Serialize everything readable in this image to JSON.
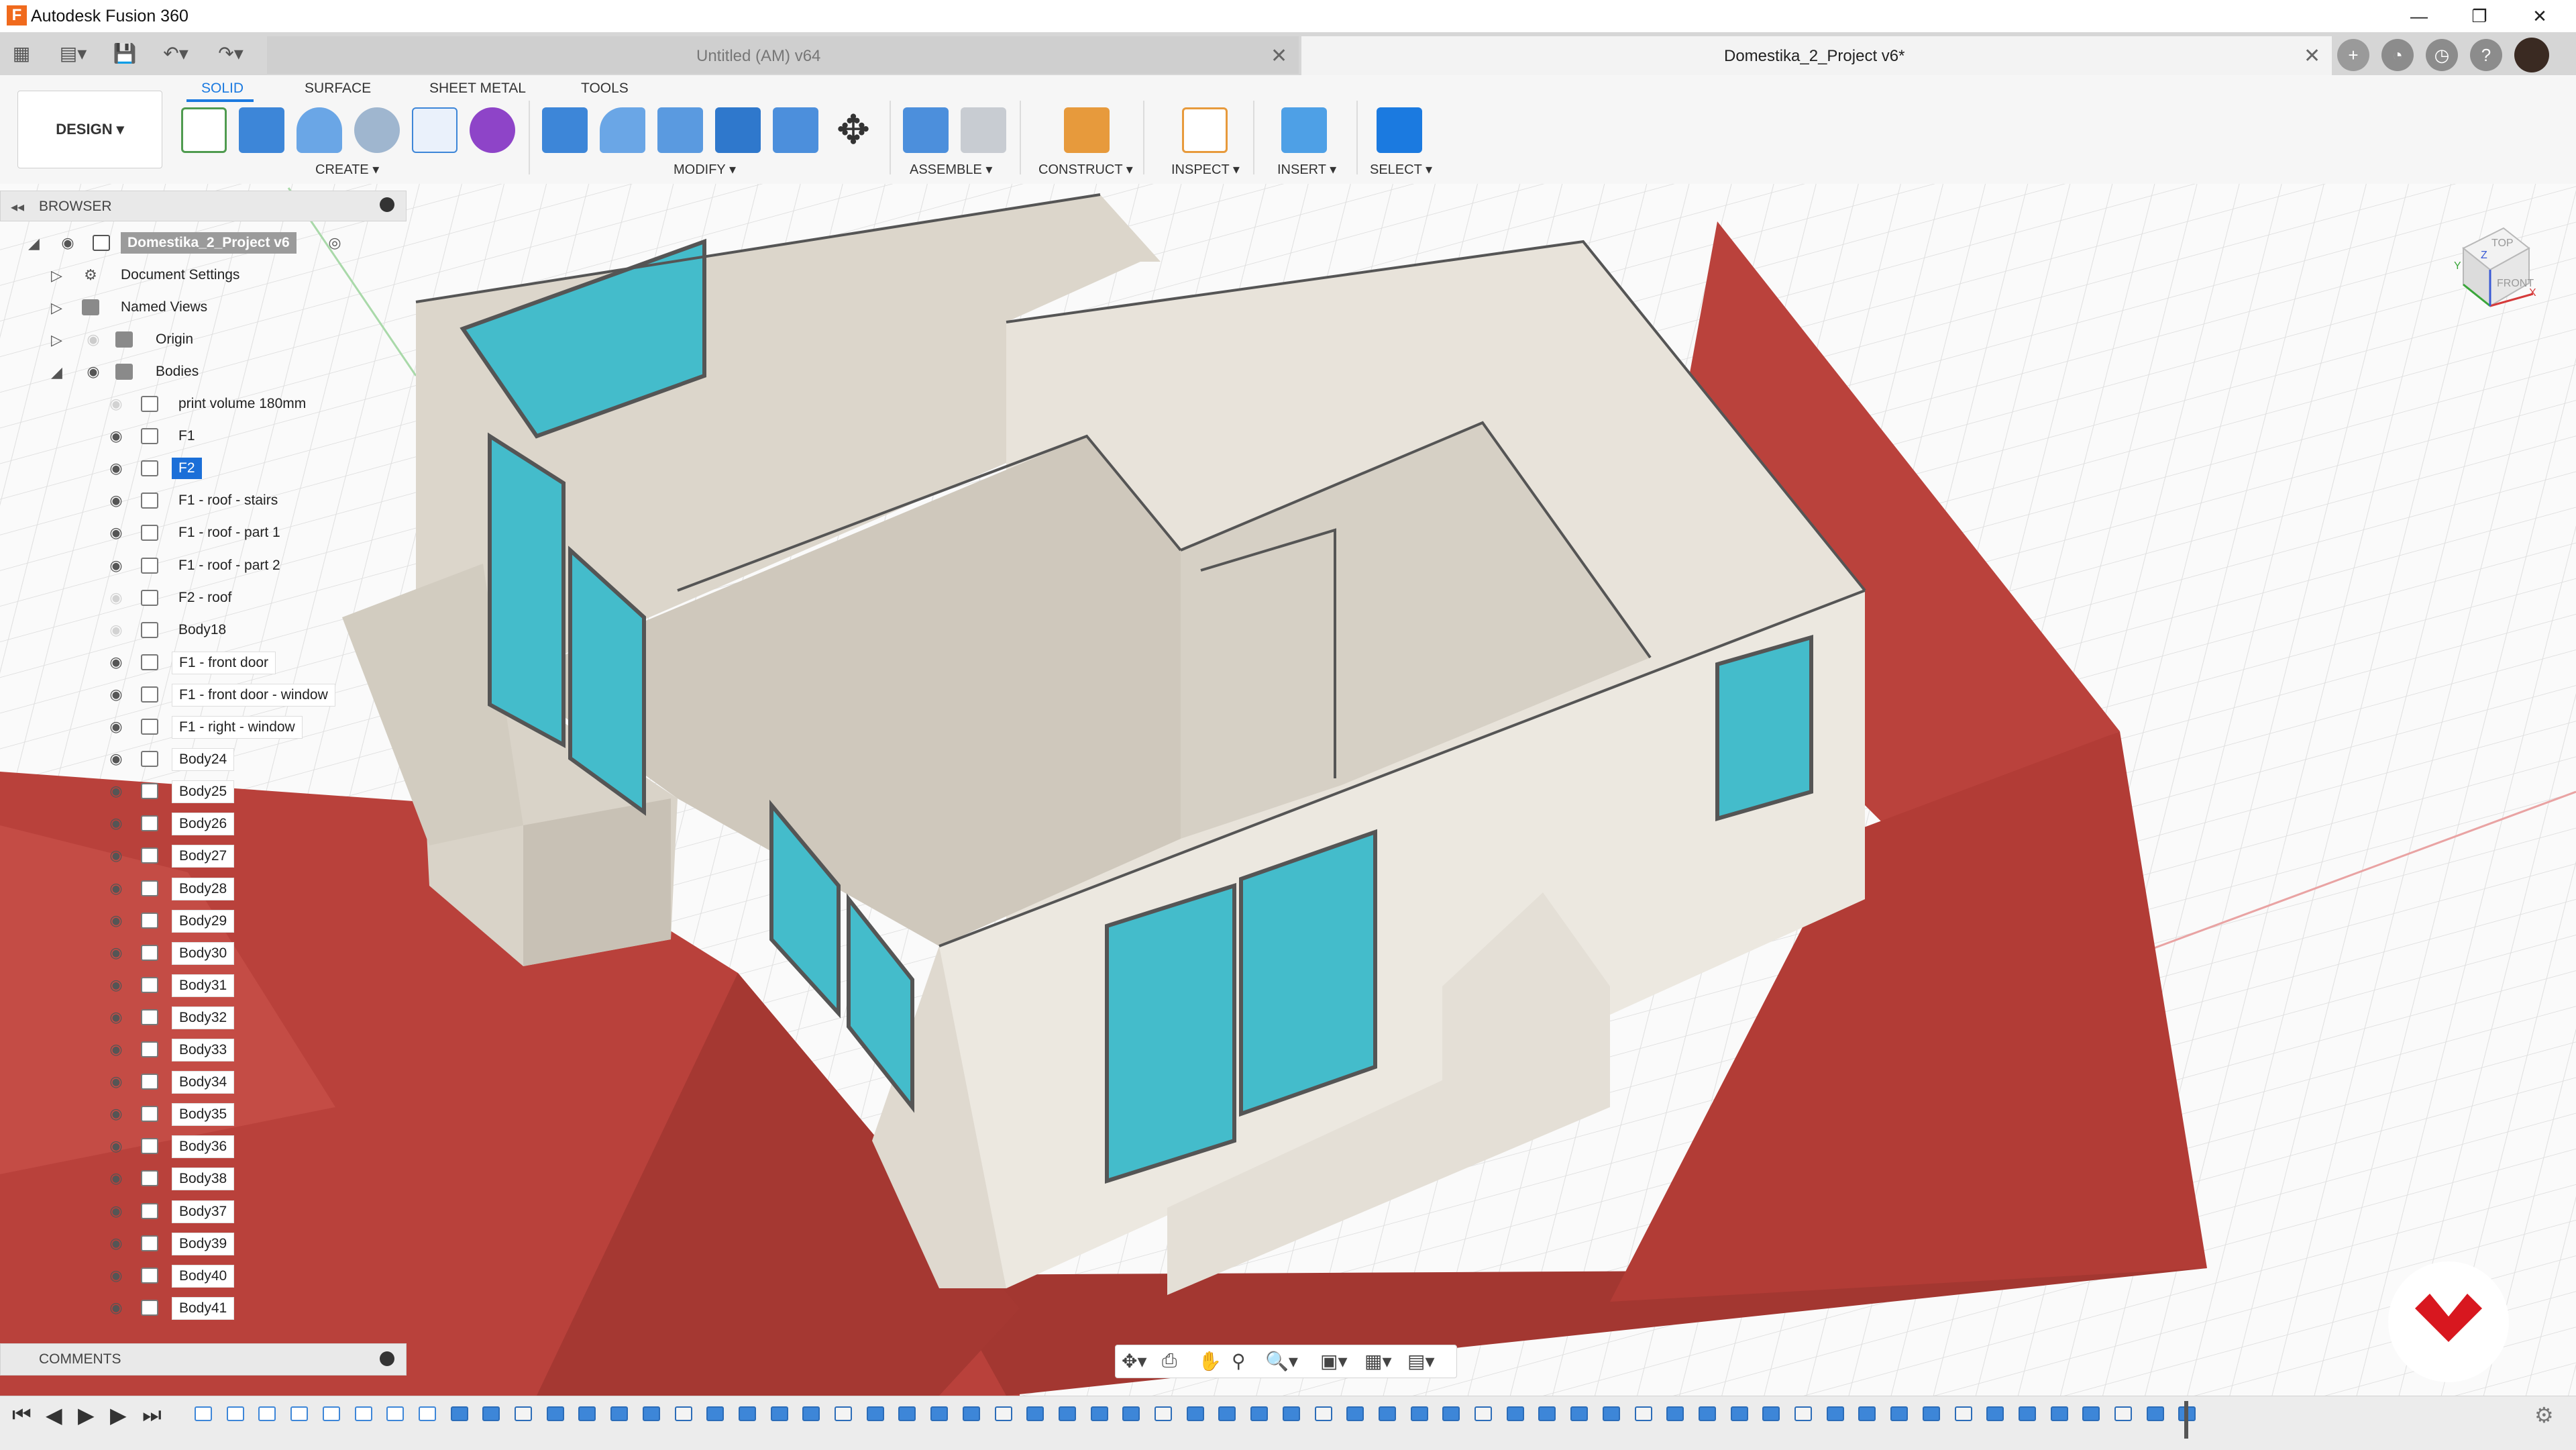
{
  "app": {
    "title": "Autodesk Fusion 360",
    "logo_letter": "F"
  },
  "window": {
    "minimize": "—",
    "restore": "❐",
    "close": "✕"
  },
  "tabs": [
    {
      "label": "Untitled (AM) v64",
      "active": false
    },
    {
      "label": "Domestika_2_Project v6*",
      "active": true
    }
  ],
  "tab_close": "✕",
  "tabbar_right_icons": [
    "+",
    "◔",
    "◷",
    "?"
  ],
  "quick_access": [
    "▦",
    "▤▾",
    "💾",
    "↶▾",
    "↷▾"
  ],
  "ribbon": {
    "tabs": [
      "SOLID",
      "SURFACE",
      "SHEET METAL",
      "TOOLS"
    ],
    "active_tab": "SOLID",
    "workspace": "DESIGN ▾",
    "groups": [
      "CREATE ▾",
      "MODIFY ▾",
      "ASSEMBLE ▾",
      "CONSTRUCT ▾",
      "INSPECT ▾",
      "INSERT ▾",
      "SELECT ▾"
    ]
  },
  "browser": {
    "title": "BROWSER",
    "root": "Domestika_2_Project v6",
    "folders": [
      "Document Settings",
      "Named Views",
      "Origin",
      "Bodies"
    ],
    "bodies": [
      {
        "name": "print volume 180mm",
        "visible": false,
        "style": "plain"
      },
      {
        "name": "F1",
        "visible": true,
        "style": "plain"
      },
      {
        "name": "F2",
        "visible": true,
        "style": "selected"
      },
      {
        "name": "F1 - roof - stairs",
        "visible": true,
        "style": "plain"
      },
      {
        "name": "F1 - roof - part 1",
        "visible": true,
        "style": "plain"
      },
      {
        "name": "F1 - roof - part 2",
        "visible": true,
        "style": "plain"
      },
      {
        "name": "F2 - roof",
        "visible": false,
        "style": "plain"
      },
      {
        "name": "Body18",
        "visible": false,
        "style": "plain"
      },
      {
        "name": "F1 - front door",
        "visible": true,
        "style": "boxed"
      },
      {
        "name": "F1 - front door - window",
        "visible": true,
        "style": "boxed"
      },
      {
        "name": "F1 - right - window",
        "visible": true,
        "style": "boxed"
      },
      {
        "name": "Body24",
        "visible": true,
        "style": "boxed"
      },
      {
        "name": "Body25",
        "visible": true,
        "style": "boxed"
      },
      {
        "name": "Body26",
        "visible": true,
        "style": "boxed"
      },
      {
        "name": "Body27",
        "visible": true,
        "style": "boxed"
      },
      {
        "name": "Body28",
        "visible": true,
        "style": "boxed"
      },
      {
        "name": "Body29",
        "visible": true,
        "style": "boxed"
      },
      {
        "name": "Body30",
        "visible": true,
        "style": "boxed"
      },
      {
        "name": "Body31",
        "visible": true,
        "style": "boxed"
      },
      {
        "name": "Body32",
        "visible": true,
        "style": "boxed"
      },
      {
        "name": "Body33",
        "visible": true,
        "style": "boxed"
      },
      {
        "name": "Body34",
        "visible": true,
        "style": "boxed"
      },
      {
        "name": "Body35",
        "visible": true,
        "style": "boxed"
      },
      {
        "name": "Body36",
        "visible": true,
        "style": "boxed"
      },
      {
        "name": "Body38",
        "visible": true,
        "style": "boxed"
      },
      {
        "name": "Body37",
        "visible": true,
        "style": "boxed"
      },
      {
        "name": "Body39",
        "visible": true,
        "style": "boxed"
      },
      {
        "name": "Body40",
        "visible": true,
        "style": "boxed"
      },
      {
        "name": "Body41",
        "visible": true,
        "style": "boxed"
      }
    ]
  },
  "comments": {
    "title": "COMMENTS"
  },
  "viewcube": {
    "top": "TOP",
    "front": "FRONT",
    "axis_x": "X",
    "axis_y": "Y",
    "axis_z": "Z"
  },
  "nav_icons": [
    "✥▾",
    "⎙",
    "✋",
    "⚲",
    "🔍▾",
    "▣▾",
    "▦▾",
    "▤▾"
  ],
  "timeline": {
    "controls": [
      "⏮",
      "◀",
      "▶",
      "▶",
      "⏭"
    ],
    "feature_count": 63,
    "settings_icon": "⚙"
  },
  "colors": {
    "accent": "#1b6fd8",
    "roof": "#b8403a",
    "wall": "#e6e1d9",
    "glass": "#46bccb",
    "logo": "#d8171f"
  }
}
